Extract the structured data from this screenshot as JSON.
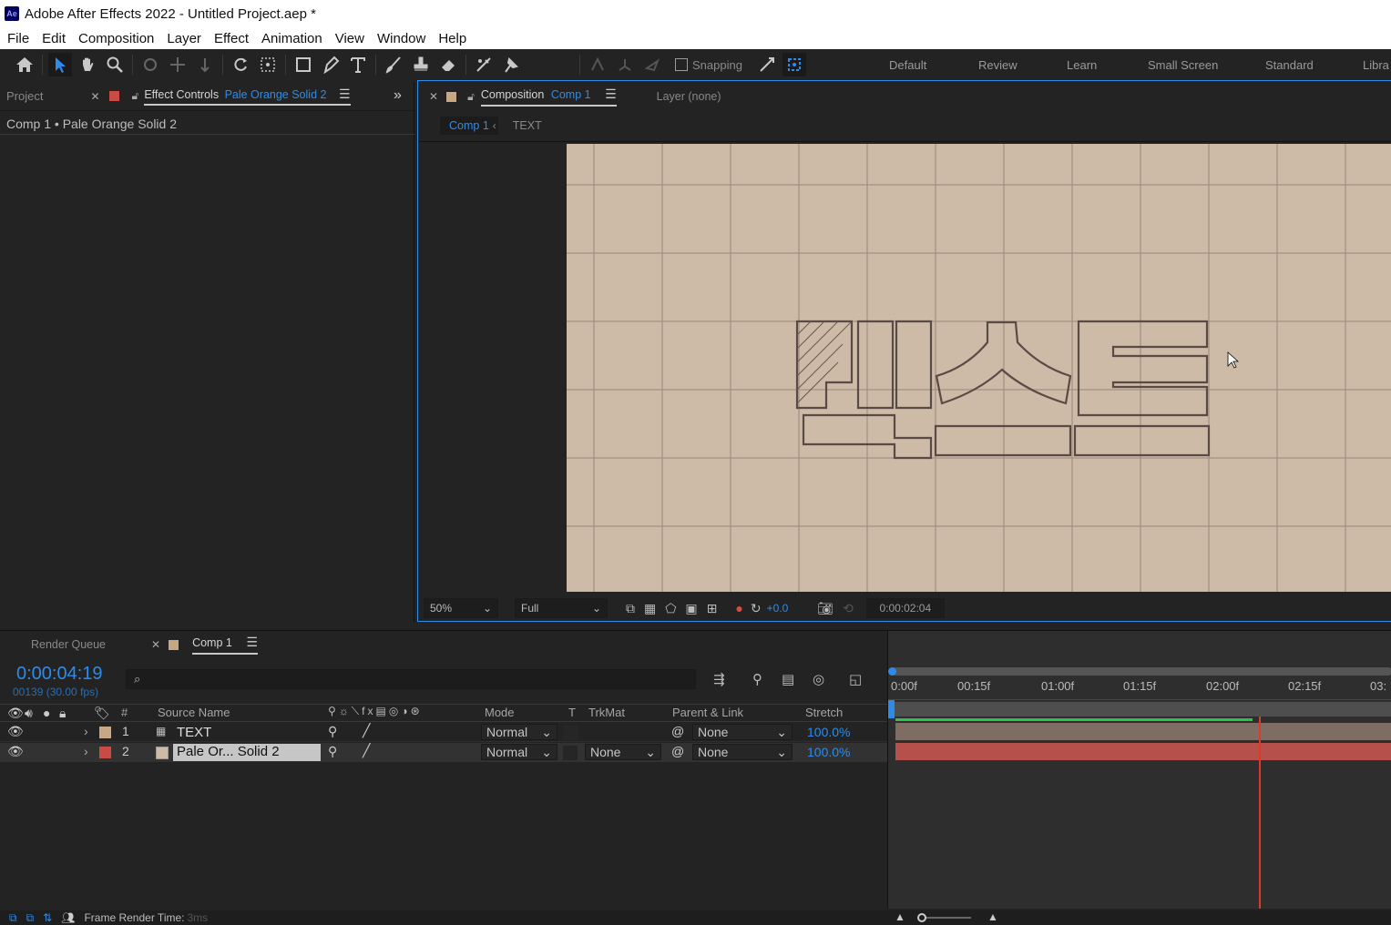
{
  "title_bar": {
    "title": "Adobe After Effects 2022 - Untitled Project.aep *",
    "logo": "Ae"
  },
  "menu": [
    "File",
    "Edit",
    "Composition",
    "Layer",
    "Effect",
    "Animation",
    "View",
    "Window",
    "Help"
  ],
  "toolbar": {
    "snapping_label": "Snapping"
  },
  "workspaces": [
    "Default",
    "Review",
    "Learn",
    "Small Screen",
    "Standard",
    "Libra"
  ],
  "left_panel": {
    "project_tab": "Project",
    "effect_controls_tab": "Effect Controls",
    "effect_controls_target": "Pale Orange Solid 2",
    "header": "Comp 1 • Pale Orange Solid 2"
  },
  "viewer": {
    "comp_tab_label": "Composition",
    "comp_tab_name": "Comp 1",
    "layer_tab": "Layer (none)",
    "breadcrumb_active": "Comp 1",
    "breadcrumb_next": "TEXT",
    "zoom": "50%",
    "resolution": "Full",
    "exposure": "+0.0",
    "timecode": "0:00:02:04"
  },
  "timeline": {
    "render_queue_tab": "Render Queue",
    "comp_tab": "Comp 1",
    "current_time": "0:00:04:19",
    "frame_info": "00139 (30.00 fps)",
    "search_placeholder": "",
    "headers": {
      "num": "#",
      "source_name": "Source Name",
      "mode": "Mode",
      "t": "T",
      "trkmat": "TrkMat",
      "parent": "Parent & Link",
      "stretch": "Stretch"
    },
    "ruler_labels": [
      "0:00f",
      "00:15f",
      "01:00f",
      "01:15f",
      "02:00f",
      "02:15f",
      "03:"
    ],
    "layers": [
      {
        "num": "1",
        "name": "TEXT",
        "mode": "Normal",
        "trkmat": "",
        "parent": "None",
        "stretch": "100.0%",
        "color": "#c8a884"
      },
      {
        "num": "2",
        "name": "Pale Or... Solid 2",
        "mode": "Normal",
        "trkmat": "None",
        "parent": "None",
        "stretch": "100.0%",
        "color": "#c94b43"
      }
    ]
  },
  "status": {
    "label": "Frame Render Time:",
    "value": "3ms"
  },
  "colors": {
    "accent": "#2d8ceb",
    "canvas": "#cdbba7",
    "layer_bar_text": "#8c7a6b",
    "layer_bar_solid": "#b5504a",
    "playhead": "#e0392b",
    "work_area": "#2ec24a"
  }
}
